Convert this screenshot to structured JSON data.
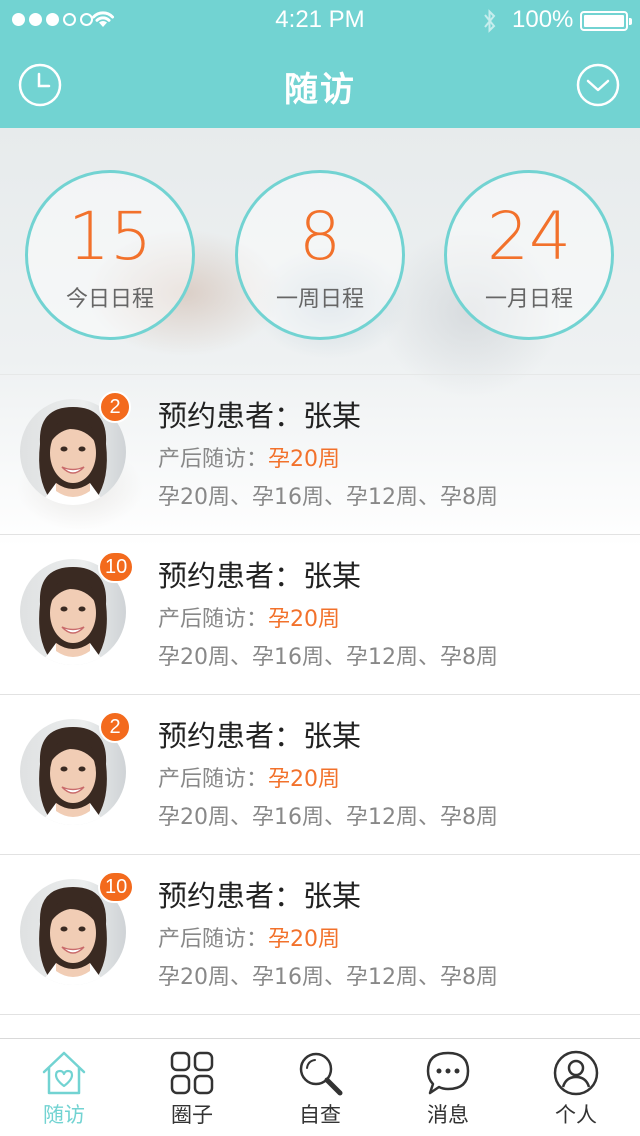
{
  "status_bar": {
    "time": "4:21 PM",
    "battery": "100%",
    "signal_bars_filled": 3,
    "signal_bars_total": 5
  },
  "nav": {
    "title": "随访",
    "left_icon": "clock-icon",
    "right_icon": "chevron-down-circle-icon"
  },
  "stats": [
    {
      "value": "15",
      "label": "今日日程"
    },
    {
      "value": "8",
      "label": "一周日程"
    },
    {
      "value": "24",
      "label": "一月日程"
    }
  ],
  "patients": [
    {
      "badge": "2",
      "name": "预约患者：张某",
      "visit_label": "产后随访：",
      "visit_value": "孕20周",
      "weeks": "孕20周、孕16周、孕12周、孕8周"
    },
    {
      "badge": "10",
      "name": "预约患者：张某",
      "visit_label": "产后随访：",
      "visit_value": "孕20周",
      "weeks": "孕20周、孕16周、孕12周、孕8周"
    },
    {
      "badge": "2",
      "name": "预约患者：张某",
      "visit_label": "产后随访：",
      "visit_value": "孕20周",
      "weeks": "孕20周、孕16周、孕12周、孕8周"
    },
    {
      "badge": "10",
      "name": "预约患者：张某",
      "visit_label": "产后随访：",
      "visit_value": "孕20周",
      "weeks": "孕20周、孕16周、孕12周、孕8周"
    }
  ],
  "tabs": [
    {
      "label": "随访",
      "icon": "home-heart-icon",
      "active": true
    },
    {
      "label": "圈子",
      "icon": "grid-icon",
      "active": false
    },
    {
      "label": "自查",
      "icon": "search-icon",
      "active": false
    },
    {
      "label": "消息",
      "icon": "chat-bubble-icon",
      "active": false
    },
    {
      "label": "个人",
      "icon": "user-icon",
      "active": false
    }
  ],
  "colors": {
    "accent": "#72d3d2",
    "highlight": "#f2712b",
    "badge": "#f36a1d"
  }
}
